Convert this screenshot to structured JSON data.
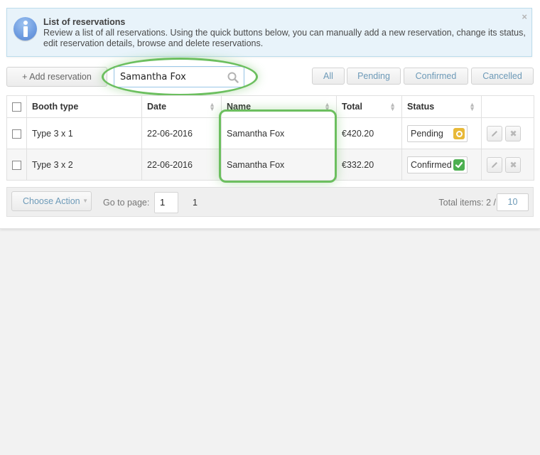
{
  "info": {
    "title": "List of reservations",
    "text": "Review a list of all reservations. Using the quick buttons below, you can manually add a new reservation, change its status, edit reservation details, browse and delete reservations.",
    "close": "×"
  },
  "toolbar": {
    "add_label": "+ Add reservation",
    "search_value": "Samantha Fox",
    "filters": [
      "All",
      "Pending",
      "Confirmed",
      "Cancelled"
    ]
  },
  "table": {
    "headers": [
      "Booth type",
      "Date",
      "Name",
      "Total",
      "Status"
    ],
    "rows": [
      {
        "booth": "Type 3 x 1",
        "date": "22-06-2016",
        "name": "Samantha Fox",
        "total": "€420.20",
        "status": "Pending"
      },
      {
        "booth": "Type 3 x 2",
        "date": "22-06-2016",
        "name": "Samantha Fox",
        "total": "€332.20",
        "status": "Confirmed"
      }
    ]
  },
  "footer": {
    "choose_action": "Choose Action",
    "goto_label": "Go to page:",
    "goto_value": "1",
    "page_count": "1",
    "total_label": "Total items: 2 /",
    "per_page": "10"
  },
  "colors": {
    "highlight": "#6cbf5f",
    "pending": "#e8b938",
    "confirmed": "#4caf50",
    "link": "#6d9ab8"
  }
}
